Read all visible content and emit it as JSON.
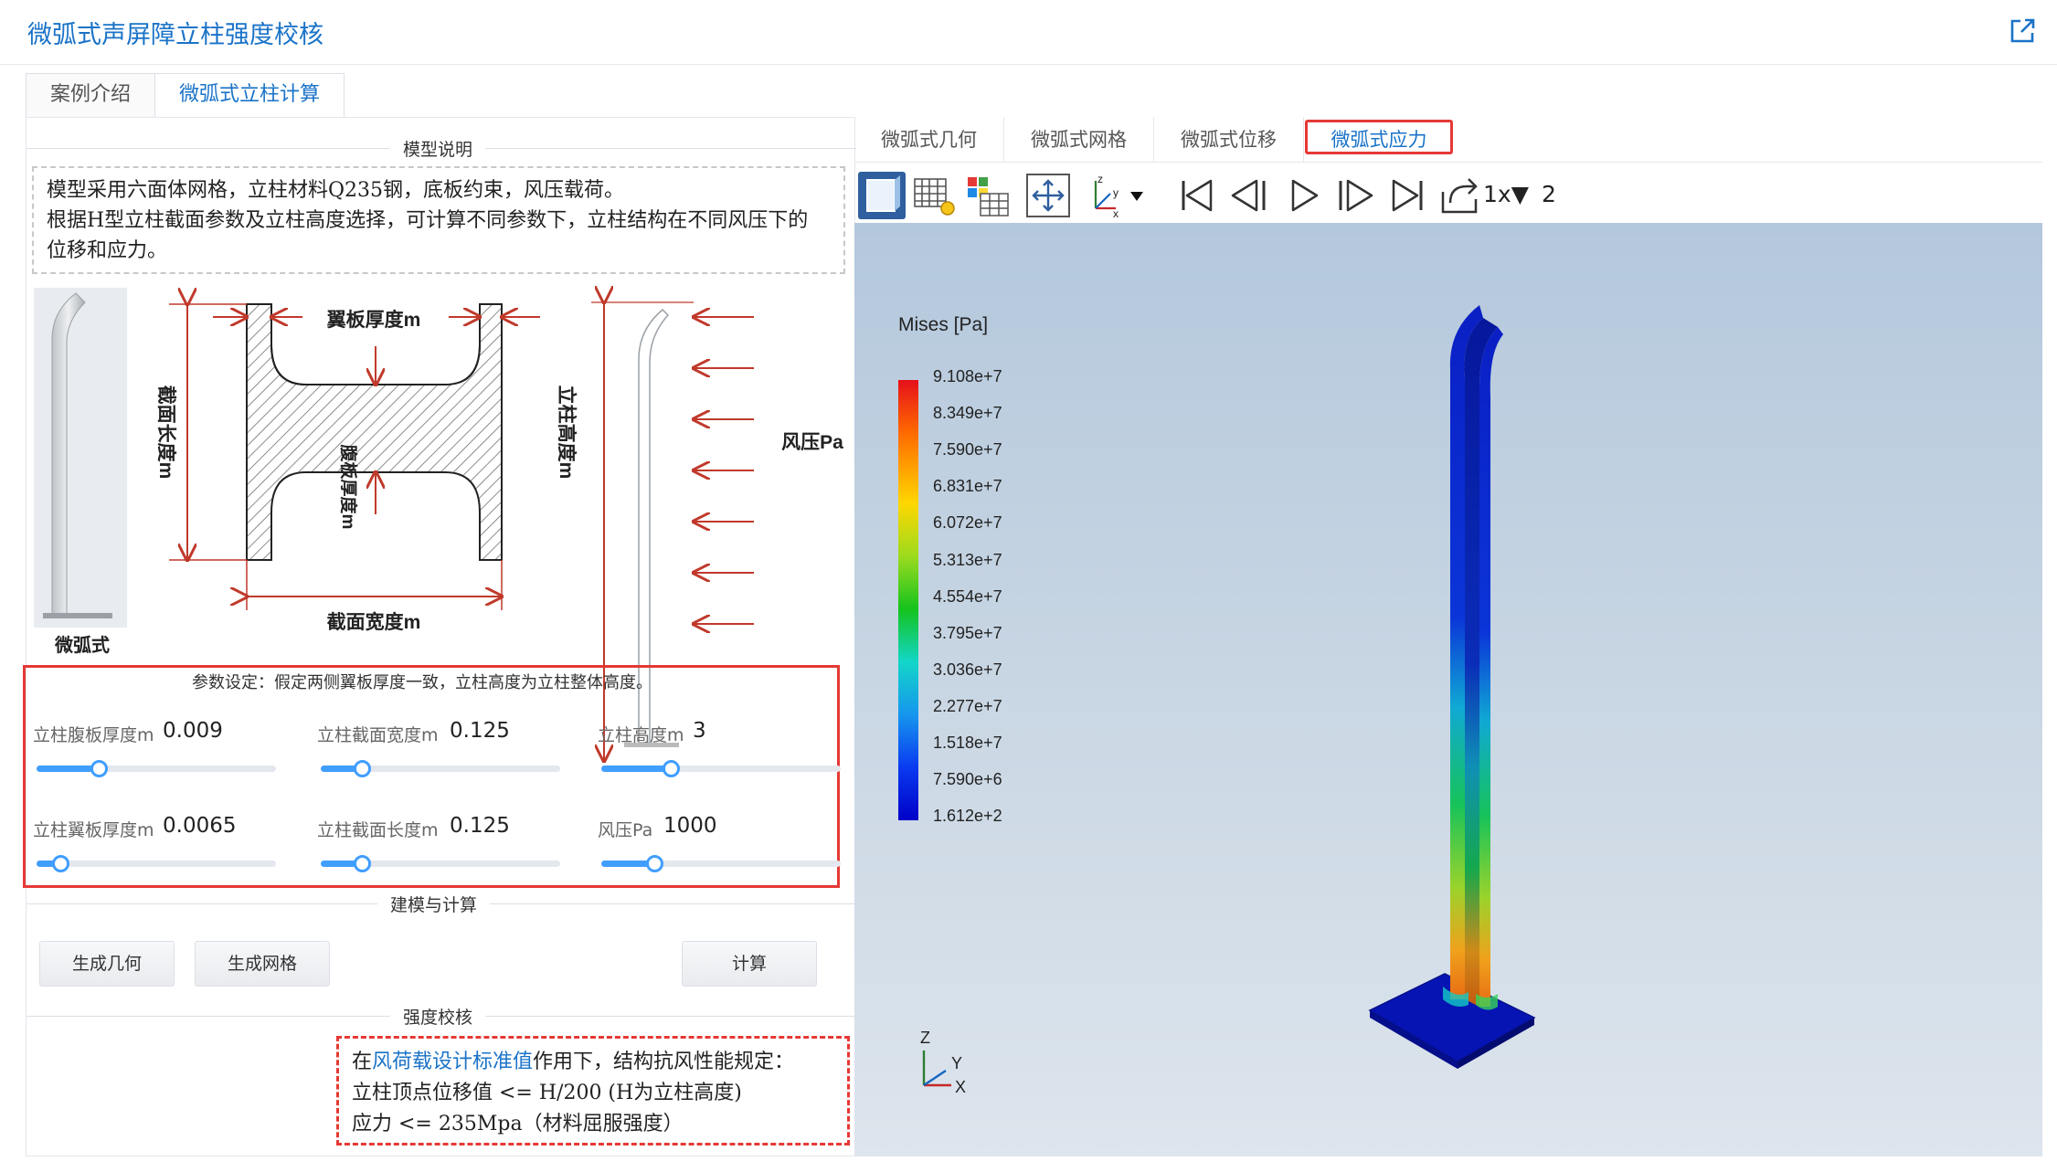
{
  "app": {
    "title": "微弧式声屏障立柱强度校核"
  },
  "main_tabs": [
    {
      "label": "案例介绍"
    },
    {
      "label": "微弧式立柱计算"
    }
  ],
  "model_section": {
    "title": "模型说明",
    "description": [
      "模型采用六面体网格，立柱材料Q235钢，底板约束，风压载荷。",
      "根据H型立柱截面参数及立柱高度选择，可计算不同参数下，立柱结构在不同风压下的",
      "位移和应力。"
    ]
  },
  "diagram": {
    "post_caption": "微弧式",
    "flange_thickness": "翼板厚度m",
    "section_length": "截面长度m",
    "web_thickness": "腹板厚度m",
    "section_width": "截面宽度m",
    "post_height": "立柱高度m",
    "wind_pressure": "风压Pa"
  },
  "params": {
    "title": "参数设定：假定两侧翼板厚度一致，立柱高度为立柱整体高度。",
    "items": [
      {
        "label": "立柱腹板厚度m",
        "value": "0.009",
        "fraction": 0.26
      },
      {
        "label": "立柱截面宽度m",
        "value": "0.125",
        "fraction": 0.17
      },
      {
        "label": "立柱高度m",
        "value": "3",
        "fraction": 0.29
      },
      {
        "label": "立柱翼板厚度m",
        "value": "0.0065",
        "fraction": 0.1
      },
      {
        "label": "立柱截面长度m",
        "value": "0.125",
        "fraction": 0.17
      },
      {
        "label": "风压Pa",
        "value": "1000",
        "fraction": 0.22
      }
    ]
  },
  "build_section": {
    "title": "建模与计算",
    "buttons": {
      "geometry": "生成几何",
      "mesh": "生成网格",
      "compute": "计算"
    }
  },
  "check_section": {
    "title": "强度校核",
    "line1_prefix": "在",
    "line1_link": "风荷载设计标准值",
    "line1_suffix": "作用下，结构抗风性能规定：",
    "line2": "立柱顶点位移值 <= H/200 (H为立柱高度)",
    "line3": "应力 <= 235Mpa（材料屈服强度）"
  },
  "viewer": {
    "tabs": [
      "微弧式几何",
      "微弧式网格",
      "微弧式位移",
      "微弧式应力"
    ],
    "active_tab": 3,
    "speed": "1x▼",
    "frame": "2",
    "legend": {
      "title": "Mises [Pa]",
      "labels": [
        "9.108e+7",
        "8.349e+7",
        "7.590e+7",
        "6.831e+7",
        "6.072e+7",
        "5.313e+7",
        "4.554e+7",
        "3.795e+7",
        "3.036e+7",
        "2.277e+7",
        "1.518e+7",
        "7.590e+6",
        "1.612e+2"
      ]
    },
    "axes": {
      "z": "Z",
      "y": "Y",
      "x": "X"
    }
  },
  "colors": {
    "accent": "#1a73c8",
    "highlight": "#e53935",
    "slider": "#409eff"
  }
}
